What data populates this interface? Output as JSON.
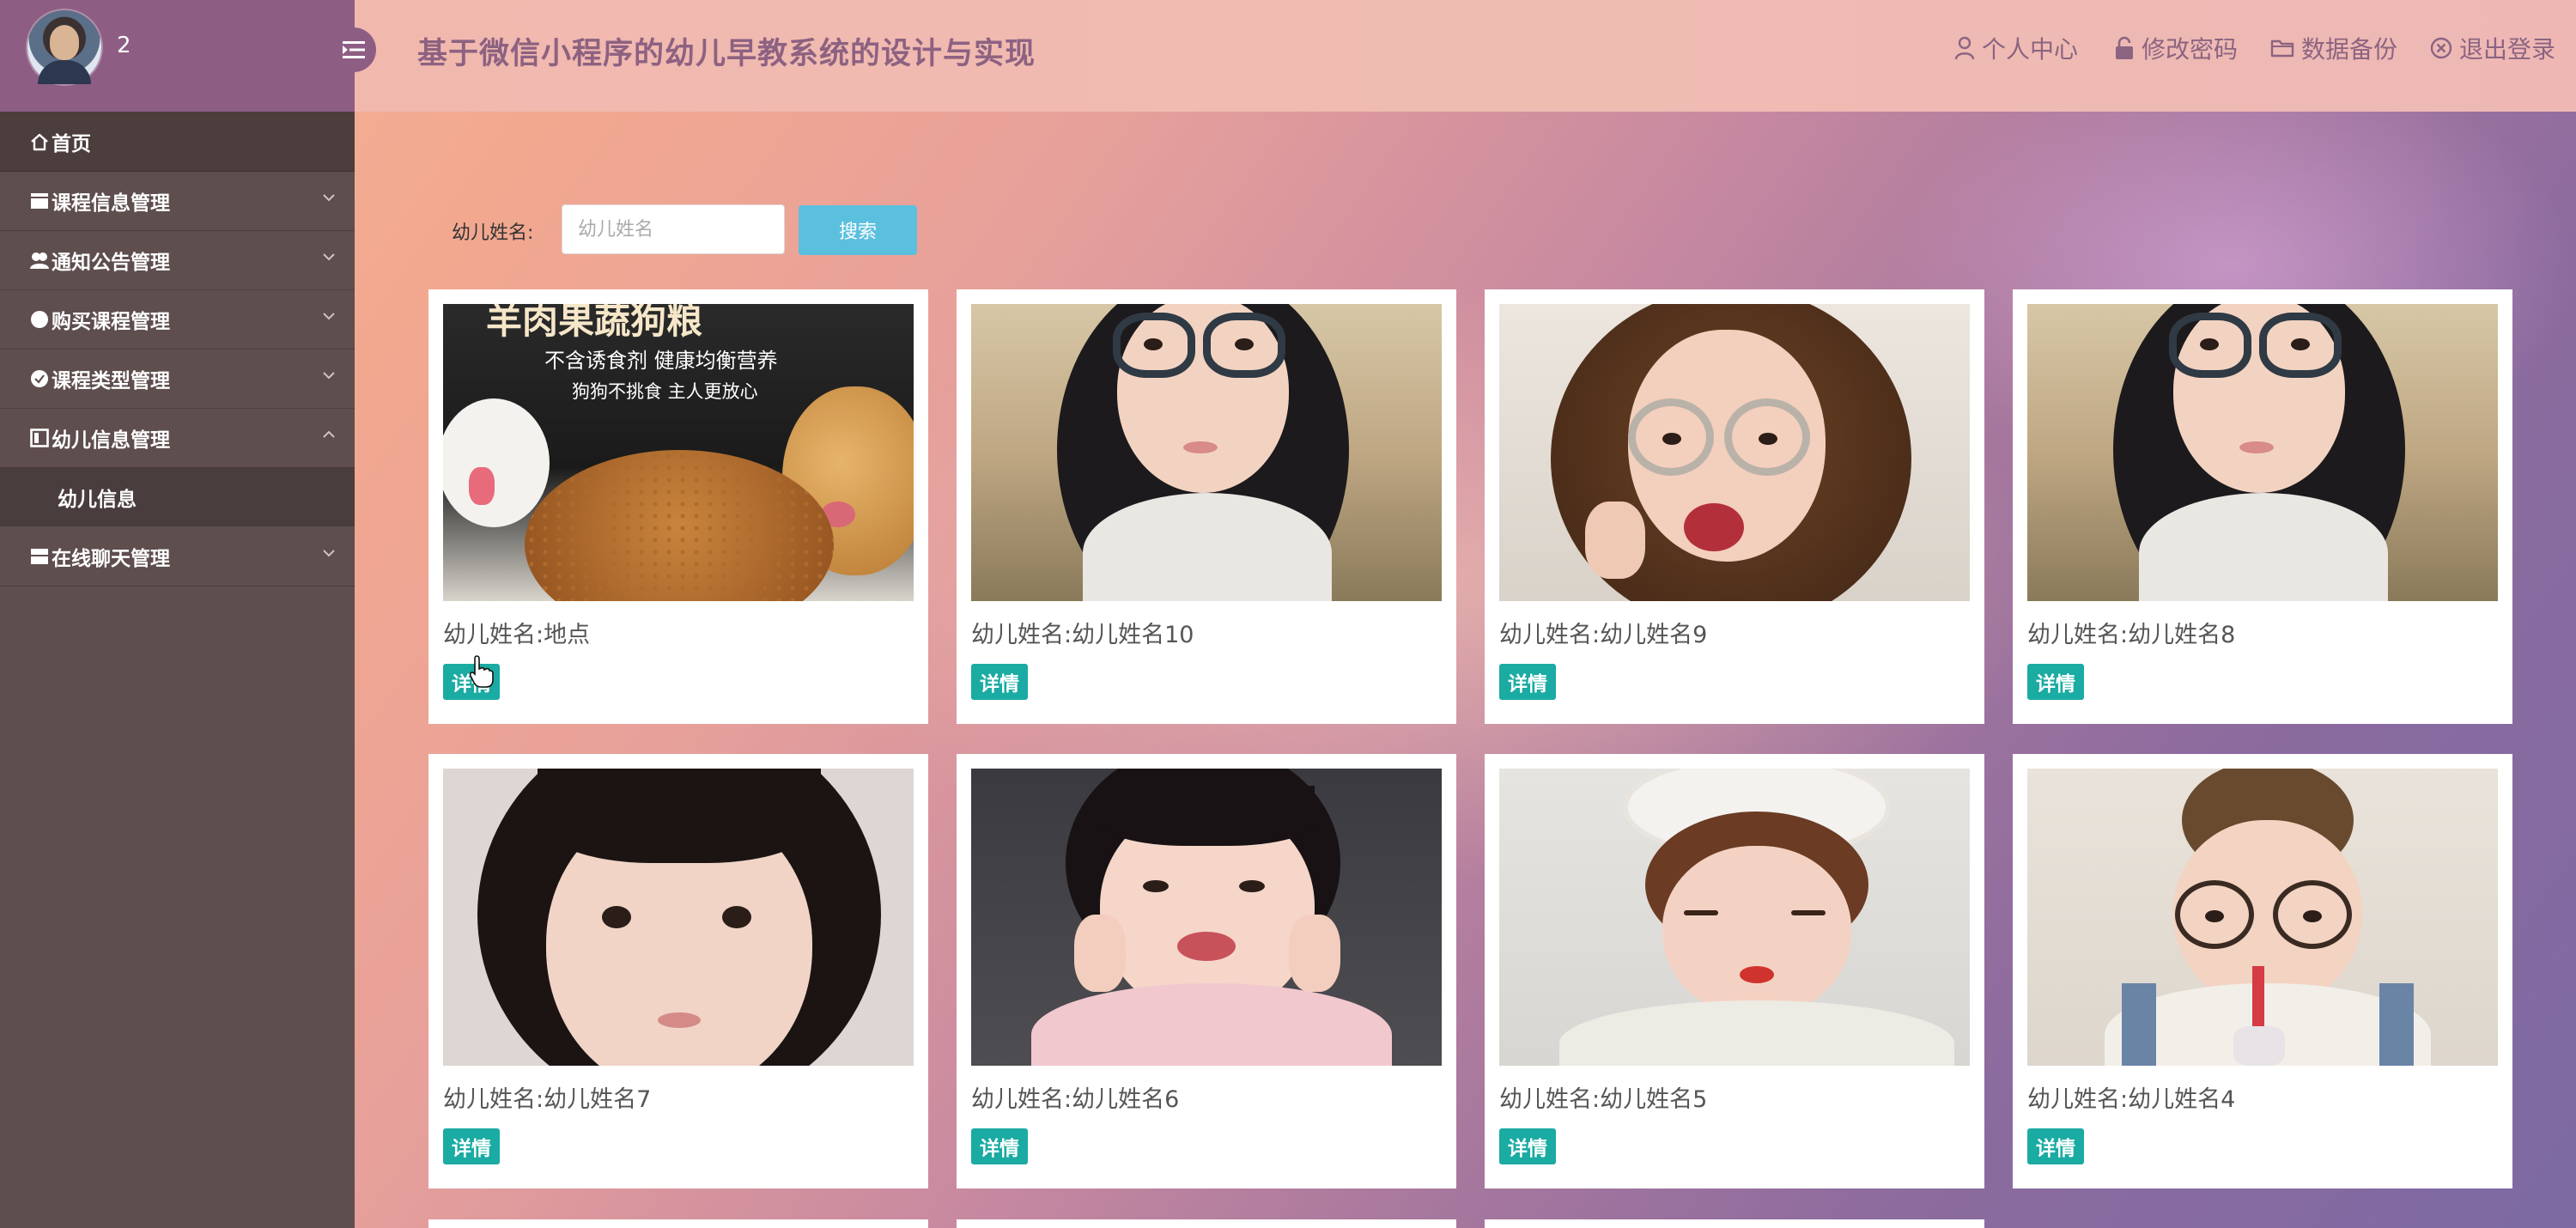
{
  "header": {
    "user_name": "2",
    "title": "基于微信小程序的幼儿早教系统的设计与实现",
    "nav": [
      {
        "label": "个人中心",
        "icon": "user-icon"
      },
      {
        "label": "修改密码",
        "icon": "lock-icon"
      },
      {
        "label": "数据备份",
        "icon": "folder-icon"
      },
      {
        "label": "退出登录",
        "icon": "close-circle-icon"
      }
    ]
  },
  "sidebar": {
    "items": [
      {
        "label": "首页",
        "icon": "home-icon"
      },
      {
        "label": "课程信息管理",
        "icon": "book-icon"
      },
      {
        "label": "通知公告管理",
        "icon": "users-icon"
      },
      {
        "label": "购买课程管理",
        "icon": "circle-icon"
      },
      {
        "label": "课程类型管理",
        "icon": "check-circle-icon"
      },
      {
        "label": "幼儿信息管理",
        "icon": "id-card-icon",
        "expanded": true,
        "children": [
          {
            "label": "幼儿信息"
          }
        ]
      },
      {
        "label": "在线聊天管理",
        "icon": "chat-icon"
      }
    ]
  },
  "search": {
    "label": "幼儿姓名:",
    "placeholder": "幼儿姓名",
    "button": "搜索"
  },
  "cards": [
    {
      "caption": "幼儿姓名:地点",
      "detail": "详情",
      "poster_line1": "羊肉果蔬狗粮",
      "poster_line2": "不含诱食剂 健康均衡营养",
      "poster_line3": "狗狗不挑食 主人更放心"
    },
    {
      "caption": "幼儿姓名:幼儿姓名10",
      "detail": "详情"
    },
    {
      "caption": "幼儿姓名:幼儿姓名9",
      "detail": "详情"
    },
    {
      "caption": "幼儿姓名:幼儿姓名8",
      "detail": "详情"
    },
    {
      "caption": "幼儿姓名:幼儿姓名7",
      "detail": "详情"
    },
    {
      "caption": "幼儿姓名:幼儿姓名6",
      "detail": "详情"
    },
    {
      "caption": "幼儿姓名:幼儿姓名5",
      "detail": "详情"
    },
    {
      "caption": "幼儿姓名:幼儿姓名4",
      "detail": "详情"
    }
  ],
  "colors": {
    "sidebar_bg": "#5f4e4e",
    "header_left_bg": "#8e5d84",
    "title_color": "#8d6181",
    "search_button": "#5bc0de",
    "detail_button": "#1aaba3"
  }
}
